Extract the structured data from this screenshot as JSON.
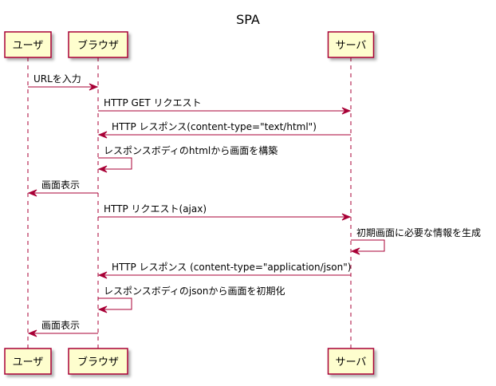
{
  "title": "SPA",
  "colors": {
    "line": "#A80036",
    "box_fill": "#FEFECE",
    "text": "#000000"
  },
  "participants": [
    {
      "id": "user",
      "label": "ユーザ"
    },
    {
      "id": "browser",
      "label": "ブラウザ"
    },
    {
      "id": "server",
      "label": "サーバ"
    }
  ],
  "messages": [
    {
      "from": "user",
      "to": "browser",
      "label": "URLを入力"
    },
    {
      "from": "browser",
      "to": "server",
      "label": "HTTP GET リクエスト"
    },
    {
      "from": "server",
      "to": "browser",
      "label": "HTTP レスポンス(content-type=\"text/html\")"
    },
    {
      "from": "browser",
      "to": "browser",
      "label": "レスポンスボディのhtmlから画面を構築"
    },
    {
      "from": "browser",
      "to": "user",
      "label": "画面表示"
    },
    {
      "from": "browser",
      "to": "server",
      "label": "HTTP リクエスト(ajax)"
    },
    {
      "from": "server",
      "to": "server",
      "label": "初期画面に必要な情報を生成"
    },
    {
      "from": "server",
      "to": "browser",
      "label": "HTTP レスポンス (content-type=\"application/json\")"
    },
    {
      "from": "browser",
      "to": "browser",
      "label": "レスポンスボディのjsonから画面を初期化"
    },
    {
      "from": "browser",
      "to": "user",
      "label": "画面表示"
    }
  ]
}
